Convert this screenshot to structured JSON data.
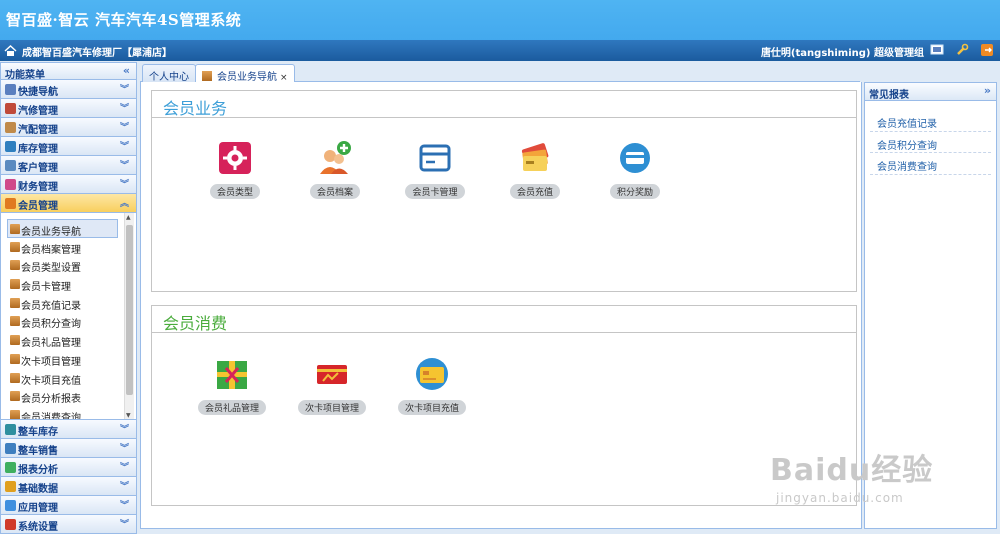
{
  "app": {
    "title": "智百盛·智云 汽车汽车4S管理系统"
  },
  "infobar": {
    "shop": "成都智百盛汽车修理厂【犀浦店】",
    "user": "唐仕明(tangshiming) 超级管理组"
  },
  "sidebar": {
    "header": "功能菜单",
    "collapse": "«",
    "groups_top": [
      {
        "label": "快捷导航",
        "icon": "home-icon",
        "color": "#5a7fbf"
      },
      {
        "label": "汽修管理",
        "icon": "tools-icon",
        "color": "#c04a3a"
      },
      {
        "label": "汽配管理",
        "icon": "parts-icon",
        "color": "#c08a4a"
      },
      {
        "label": "库存管理",
        "icon": "warehouse-icon",
        "color": "#2f7fbf"
      },
      {
        "label": "客户管理",
        "icon": "customer-icon",
        "color": "#5a8ac0"
      },
      {
        "label": "财务管理",
        "icon": "finance-icon",
        "color": "#d04a8a"
      }
    ],
    "active_group": {
      "label": "会员管理",
      "icon": "member-icon",
      "color": "#e07a20"
    },
    "sub_items": [
      "会员业务导航",
      "会员档案管理",
      "会员类型设置",
      "会员卡管理",
      "会员充值记录",
      "会员积分查询",
      "会员礼品管理",
      "次卡项目管理",
      "次卡项目充值",
      "会员分析报表",
      "会员消费查询"
    ],
    "groups_bottom": [
      {
        "label": "整车库存",
        "icon": "car-stock-icon",
        "color": "#2f8f9f"
      },
      {
        "label": "整车销售",
        "icon": "car-sales-icon",
        "color": "#3f7fbf"
      },
      {
        "label": "报表分析",
        "icon": "chart-icon",
        "color": "#3faf5f"
      },
      {
        "label": "基础数据",
        "icon": "database-icon",
        "color": "#e0a020"
      },
      {
        "label": "应用管理",
        "icon": "app-icon",
        "color": "#3f8fdf"
      },
      {
        "label": "系统设置",
        "icon": "settings-icon",
        "color": "#d03a2a"
      }
    ]
  },
  "tabs": [
    {
      "label": "个人中心"
    },
    {
      "label": "会员业务导航",
      "close": "×"
    }
  ],
  "panels": {
    "business": {
      "title": "会员业务",
      "tiles": [
        "会员类型",
        "会员档案",
        "会员卡管理",
        "会员充值",
        "积分奖励"
      ]
    },
    "consumption": {
      "title": "会员消费",
      "tiles": [
        "会员礼品管理",
        "次卡项目管理",
        "次卡项目充值"
      ]
    }
  },
  "reports": {
    "title": "常见报表",
    "expand": "»",
    "links": [
      "会员充值记录",
      "会员积分查询",
      "会员消费查询"
    ]
  },
  "watermark": {
    "brand": "Baidu经验",
    "url": "jingyan.baidu.com"
  }
}
